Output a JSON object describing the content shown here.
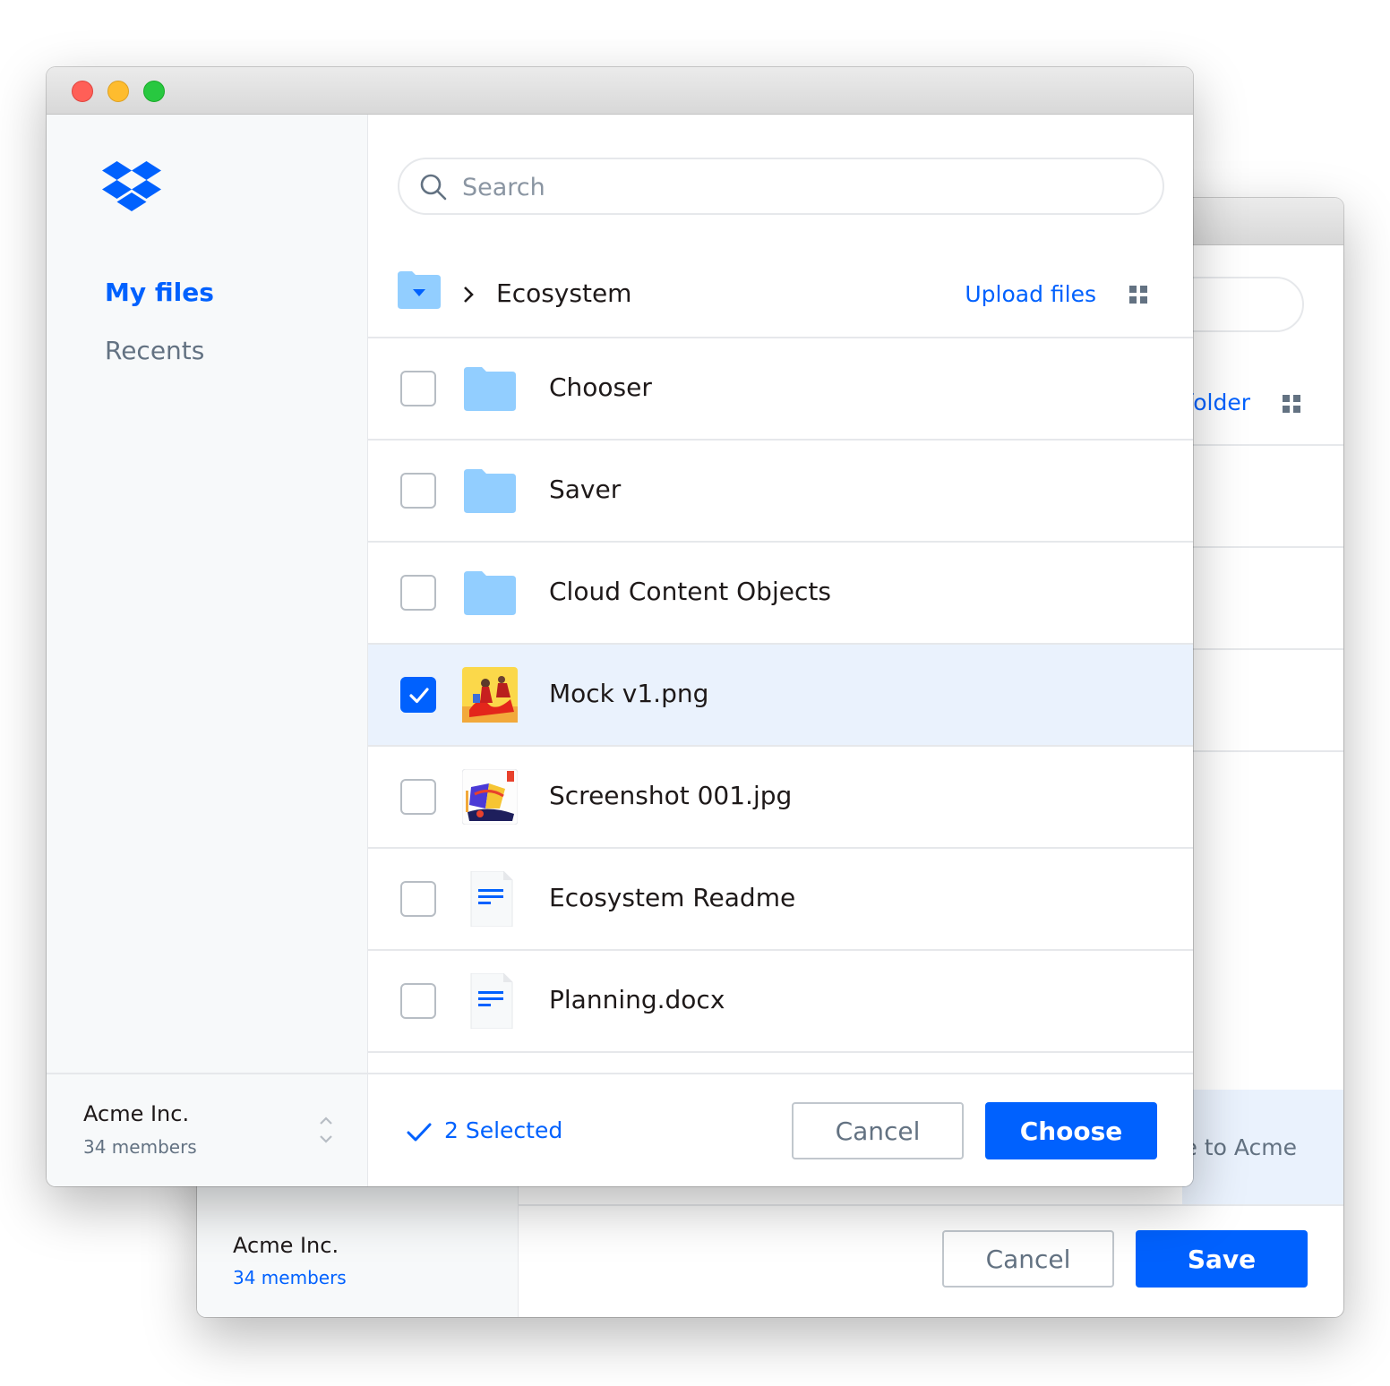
{
  "colors": {
    "accent": "#0061fe",
    "folder": "#92ceff",
    "selected_row": "#eaf2fd",
    "muted_text": "#637282"
  },
  "back_window": {
    "partial_link": "folder",
    "partial_destination": "e to Acme",
    "team": {
      "name": "Acme Inc.",
      "members": "34 members"
    },
    "buttons": {
      "cancel": "Cancel",
      "save": "Save"
    }
  },
  "front_window": {
    "sidebar": {
      "logo_icon": "dropbox-logo",
      "nav": [
        {
          "label": "My files",
          "active": true
        },
        {
          "label": "Recents",
          "active": false
        }
      ],
      "account": {
        "name": "Acme Inc.",
        "members": "34 members",
        "switch_icon": "chevron-up-down-icon"
      }
    },
    "search": {
      "placeholder": "Search",
      "value": ""
    },
    "breadcrumb": {
      "folder": "Ecosystem"
    },
    "toolbar": {
      "upload_label": "Upload files",
      "view_icon": "grid-view-icon"
    },
    "files": [
      {
        "name": "Chooser",
        "kind": "folder",
        "checked": false
      },
      {
        "name": "Saver",
        "kind": "folder",
        "checked": false
      },
      {
        "name": "Cloud Content Objects",
        "kind": "folder",
        "checked": false
      },
      {
        "name": "Mock v1.png",
        "kind": "image",
        "checked": true
      },
      {
        "name": "Screenshot 001.jpg",
        "kind": "image",
        "checked": false
      },
      {
        "name": "Ecosystem Readme",
        "kind": "document",
        "checked": false
      },
      {
        "name": "Planning.docx",
        "kind": "document",
        "checked": false
      }
    ],
    "footer": {
      "selected_label": "2 Selected",
      "cancel_label": "Cancel",
      "choose_label": "Choose"
    }
  }
}
